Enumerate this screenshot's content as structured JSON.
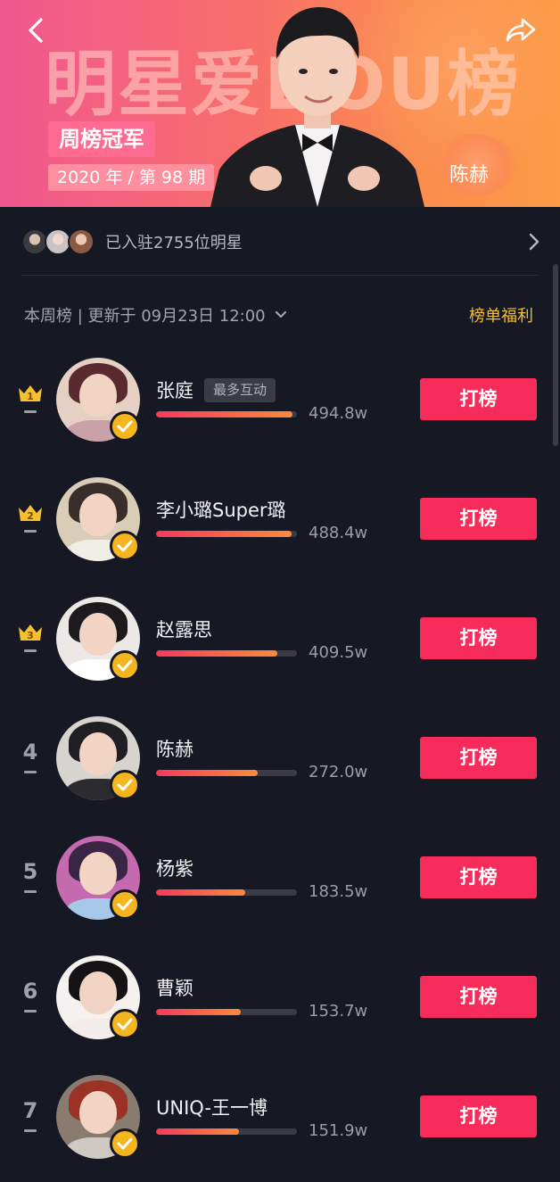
{
  "banner": {
    "title": "明星爱DOU榜",
    "champion_label": "周榜冠军",
    "issue": "2020 年 / 第 98 期",
    "champion_name": "陈赫"
  },
  "stars_row": {
    "text": "已入驻2755位明星"
  },
  "board": {
    "update_text": "本周榜 | 更新于 09月23日 12:00",
    "welfare_label": "榜单福利"
  },
  "vote_label": "打榜",
  "colors": {
    "accent": "#f72c5b",
    "gold": "#f5bf2f",
    "background": "#161823"
  },
  "ranking": [
    {
      "rank": "1",
      "crown": true,
      "name": "张庭",
      "tag": "最多互动",
      "score": "494.8w",
      "progress": 0.97
    },
    {
      "rank": "2",
      "crown": true,
      "name": "李小璐Super璐",
      "tag": "",
      "score": "488.4w",
      "progress": 0.96
    },
    {
      "rank": "3",
      "crown": true,
      "name": "赵露思",
      "tag": "",
      "score": "409.5w",
      "progress": 0.86
    },
    {
      "rank": "4",
      "crown": false,
      "name": "陈赫",
      "tag": "",
      "score": "272.0w",
      "progress": 0.72
    },
    {
      "rank": "5",
      "crown": false,
      "name": "杨紫",
      "tag": "",
      "score": "183.5w",
      "progress": 0.63
    },
    {
      "rank": "6",
      "crown": false,
      "name": "曹颖",
      "tag": "",
      "score": "153.7w",
      "progress": 0.6
    },
    {
      "rank": "7",
      "crown": false,
      "name": "UNIQ-王一博",
      "tag": "",
      "score": "151.9w",
      "progress": 0.59
    }
  ]
}
